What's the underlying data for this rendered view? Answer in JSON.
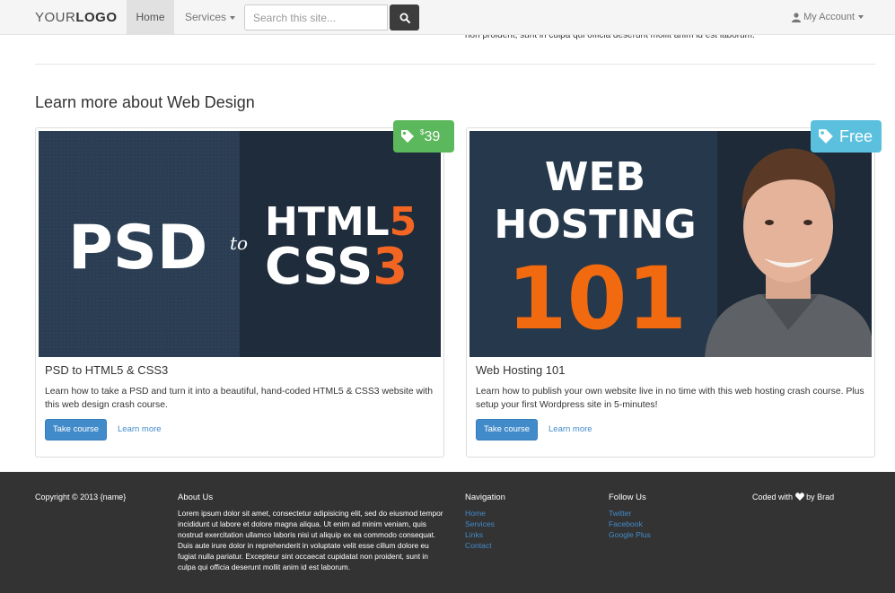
{
  "navbar": {
    "logo_light": "YOUR",
    "logo_bold": "LOGO",
    "home_label": "Home",
    "services_label": "Services",
    "search_placeholder": "Search this site...",
    "account_label": "My Account"
  },
  "top_snippet": "non proident, sunt in culpa qui officia deserunt mollit anim id est laborum.",
  "section_title": "Learn more about Web Design",
  "courses": [
    {
      "price_currency": "$",
      "price_value": "39",
      "image_text": {
        "left": "PSD",
        "middle": "to",
        "right_line1": "HTML",
        "right_line1_accent": "5",
        "right_line2": "CSS",
        "right_line2_accent": "3"
      },
      "title": "PSD to HTML5 & CSS3",
      "description": "Learn how to take a PSD and turn it into a beautiful, hand-coded HTML5 & CSS3 website with this web design crash course.",
      "take_label": "Take course",
      "more_label": "Learn more"
    },
    {
      "price_label": "Free",
      "image_text": {
        "line1": "WEB",
        "line2": "HOSTING",
        "line3": "101"
      },
      "title": "Web Hosting 101",
      "description": "Learn how to publish your own website live in no time with this web hosting crash course. Plus setup your first Wordpress site in 5-minutes!",
      "take_label": "Take course",
      "more_label": "Learn more"
    }
  ],
  "footer": {
    "copyright": "Copyright © 2013 {name}",
    "about_heading": "About Us",
    "about_text": "Lorem ipsum dolor sit amet, consectetur adipisicing elit, sed do eiusmod tempor incididunt ut labore et dolore magna aliqua. Ut enim ad minim veniam, quis nostrud exercitation ullamco laboris nisi ut aliquip ex ea commodo consequat. Duis aute irure dolor in reprehenderit in voluptate velit esse cillum dolore eu fugiat nulla pariatur. Excepteur sint occaecat cupidatat non proident, sunt in culpa qui officia deserunt mollit anim id est laborum.",
    "nav_heading": "Navigation",
    "nav_links": [
      "Home",
      "Services",
      "Links",
      "Contact"
    ],
    "follow_heading": "Follow Us",
    "follow_links": [
      "Twitter",
      "Facebook",
      "Google Plus"
    ],
    "coded_prefix": "Coded with",
    "coded_suffix": "by Brad"
  },
  "colors": {
    "primary": "#428bca",
    "badge_green": "#5cb85c",
    "badge_blue": "#5bc0de",
    "accent_orange": "#f26522",
    "footer_bg": "#333333"
  }
}
